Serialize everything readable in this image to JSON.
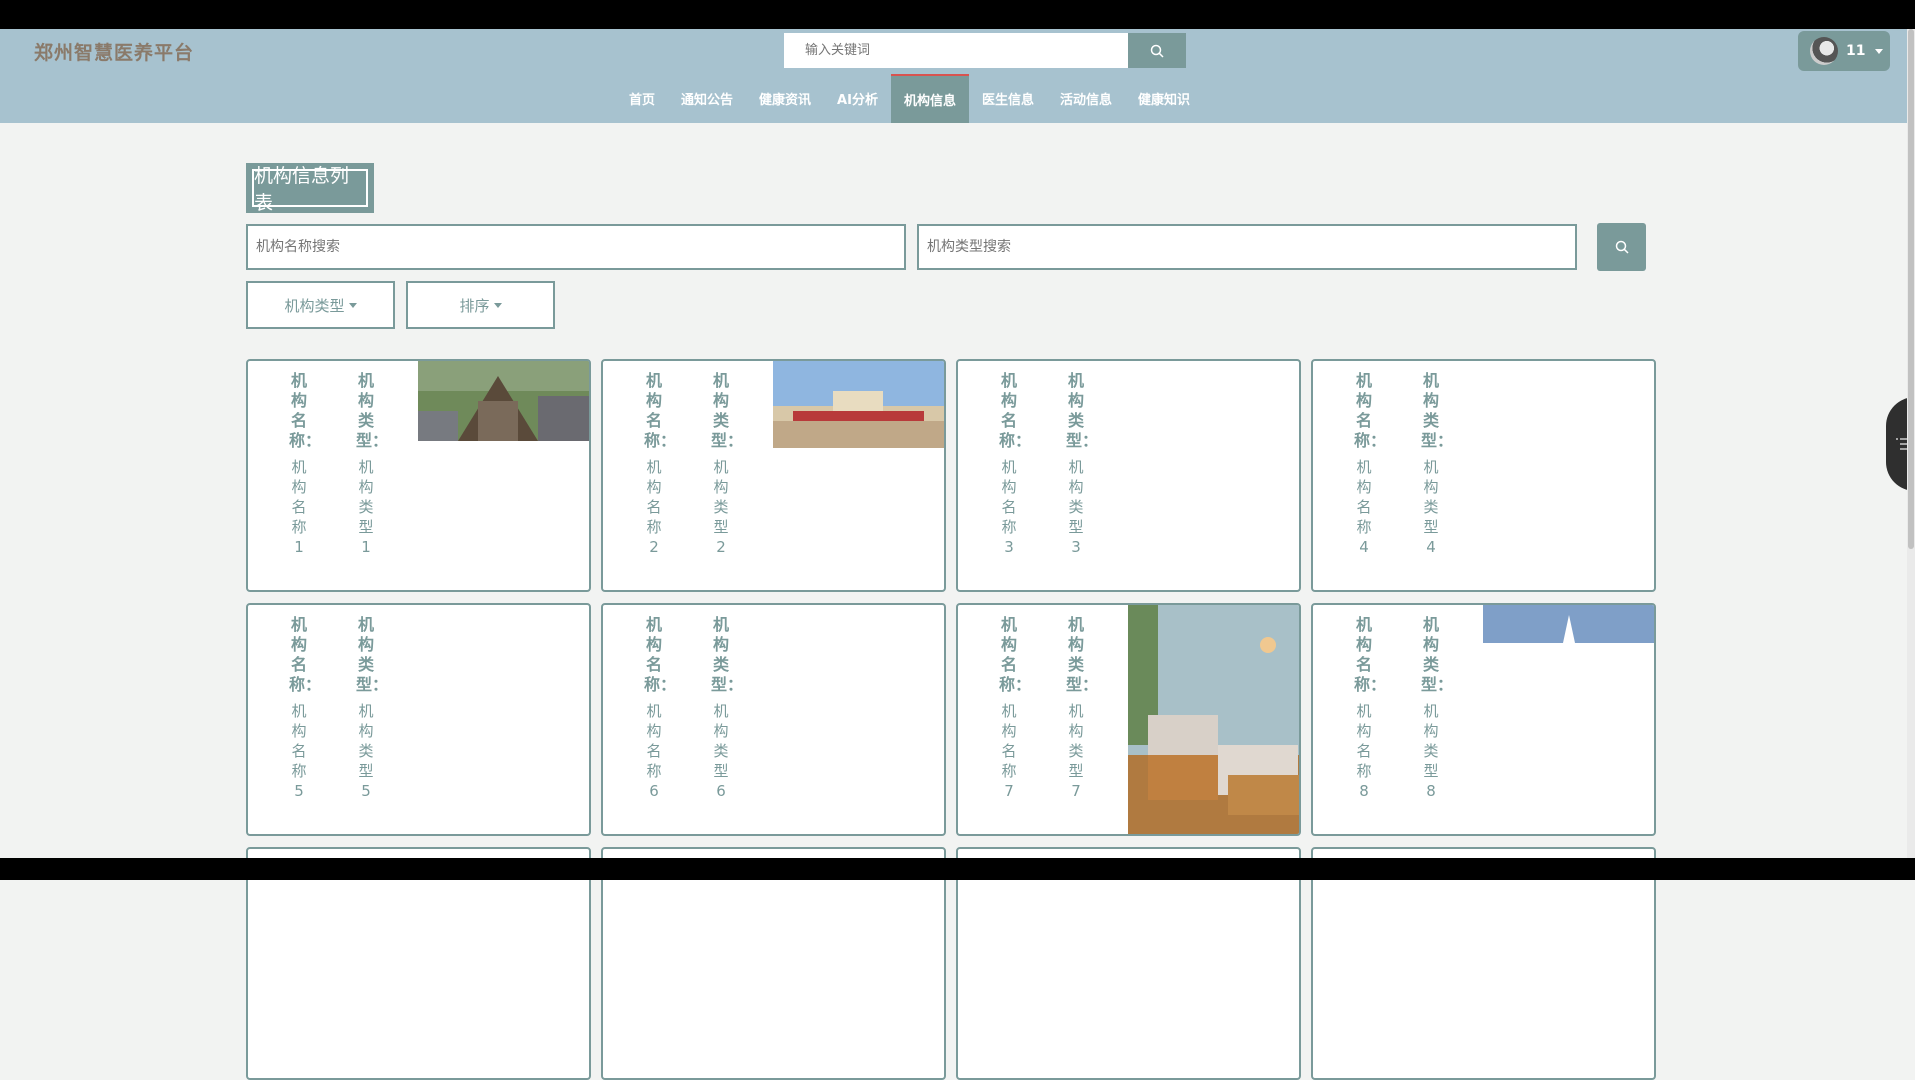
{
  "app": {
    "logo": "郑州智慧医养平台"
  },
  "header": {
    "search": {
      "placeholder": "输入关键词"
    },
    "user": {
      "name": "11"
    }
  },
  "nav": [
    {
      "label": "首页"
    },
    {
      "label": "通知公告"
    },
    {
      "label": "健康资讯"
    },
    {
      "label": "AI分析"
    },
    {
      "label": "机构信息",
      "active": true
    },
    {
      "label": "医生信息"
    },
    {
      "label": "活动信息"
    },
    {
      "label": "健康知识"
    }
  ],
  "page": {
    "title": "机构信息列表",
    "filters": {
      "name_placeholder": "机构名称搜索",
      "type_placeholder": "机构类型搜索",
      "type_dropdown": "机构类型",
      "sort_dropdown": "排序"
    }
  },
  "cards": [
    {
      "name_label": "机构名称：",
      "name": "机构名称1",
      "type_label": "机构类型：",
      "type": "机构类型1",
      "image": "building-photo"
    },
    {
      "name_label": "机构名称：",
      "name": "机构名称2",
      "type_label": "机构类型：",
      "type": "机构类型2",
      "image": "facade-photo"
    },
    {
      "name_label": "机构名称：",
      "name": "机构名称3",
      "type_label": "机构类型：",
      "type": "机构类型3",
      "image": ""
    },
    {
      "name_label": "机构名称：",
      "name": "机构名称4",
      "type_label": "机构类型：",
      "type": "机构类型4",
      "image": ""
    },
    {
      "name_label": "机构名称：",
      "name": "机构名称5",
      "type_label": "机构类型：",
      "type": "机构类型5",
      "image": ""
    },
    {
      "name_label": "机构名称：",
      "name": "机构名称6",
      "type_label": "机构类型：",
      "type": "机构类型6",
      "image": ""
    },
    {
      "name_label": "机构名称：",
      "name": "机构名称7",
      "type_label": "机构类型：",
      "type": "机构类型7",
      "image": "bedroom-photo"
    },
    {
      "name_label": "机构名称：",
      "name": "机构名称8",
      "type_label": "机构类型：",
      "type": "机构类型8",
      "image": "sky-roof-photo"
    }
  ],
  "icons": {
    "search": "search-icon",
    "menu": "menu-icon",
    "caret": "caret-down-icon"
  },
  "colors": {
    "header": "#a7c2cf",
    "accent": "#7a9a9a",
    "active_border": "#d9534f",
    "logo": "#8a7a6a"
  }
}
